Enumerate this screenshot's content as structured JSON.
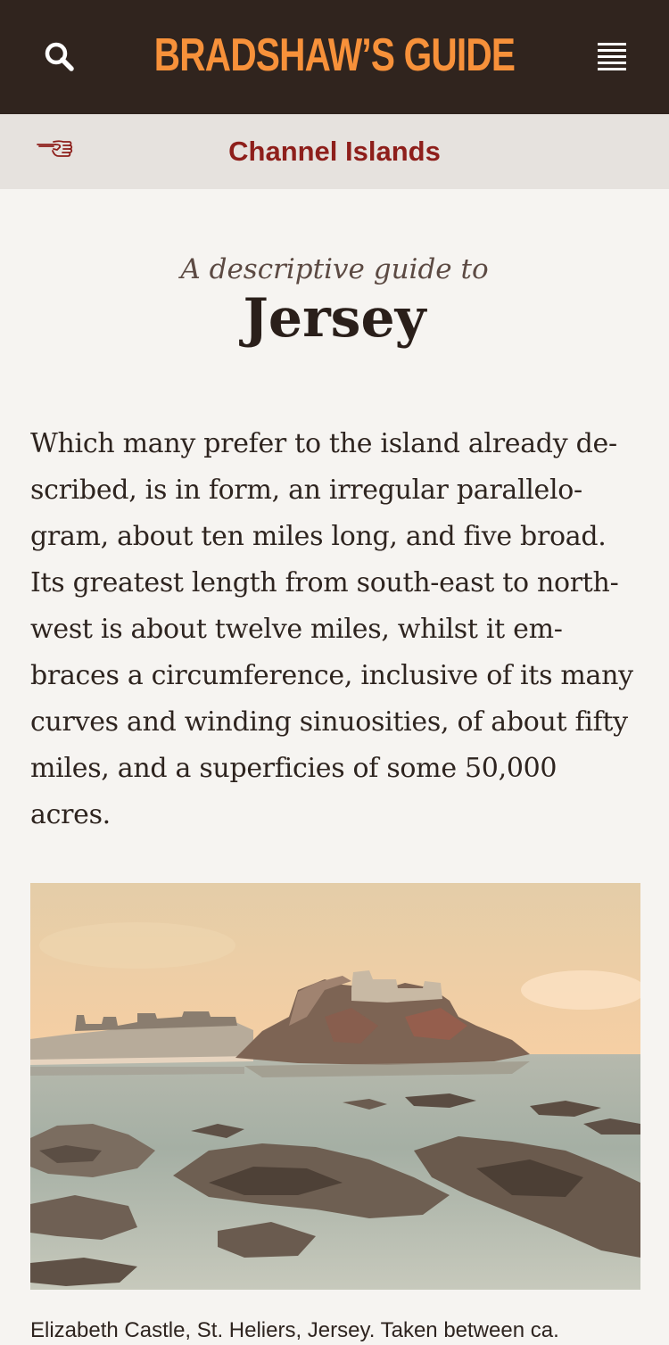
{
  "header": {
    "brand": "BRADSHAW’S GUIDE",
    "search_icon": "search-icon",
    "menu_icon": "hamburger-menu-icon",
    "colors": {
      "background": "#30241e",
      "brand": "#f7913a"
    }
  },
  "subheader": {
    "title": "Channel Islands",
    "back_icon": "pointing-hand-icon",
    "colors": {
      "background": "#e6e2de",
      "title": "#8e1f1b"
    }
  },
  "article": {
    "kicker": "A descriptive guide to",
    "title": "Jersey",
    "body": "Which many prefer to the island already de-scribed, is in form, an irregular parallelo-gram, about ten miles long, and five broad. Its greatest length from south-east to north-west is about twelve miles, whilst it em-braces a circumference, inclusive of its many curves and winding sinuosities, of about fifty miles, and a superficies of some 50,000 acres.",
    "image_caption": "Elizabeth Castle, St. Heliers, Jersey. Taken between ca."
  }
}
